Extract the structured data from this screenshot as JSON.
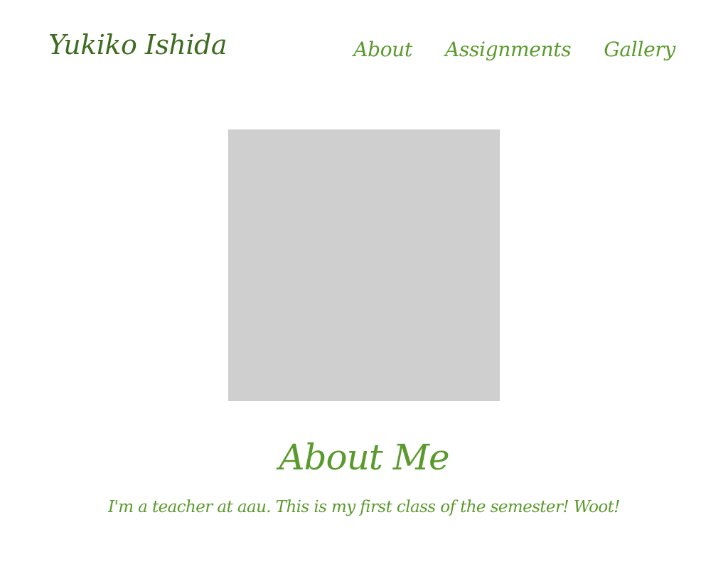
{
  "site": {
    "title": "Yukiko Ishida"
  },
  "nav": {
    "items": [
      {
        "label": "About"
      },
      {
        "label": "Assignments"
      },
      {
        "label": "Gallery"
      }
    ]
  },
  "profile": {
    "photo_placeholder_color": "#cfcfcf"
  },
  "about": {
    "heading": "About Me",
    "text": "I'm a teacher at aau. This is my first class of the semester! Woot!"
  },
  "colors": {
    "title": "#3d6b1f",
    "accent": "#5a9a2c",
    "background": "#ffffff"
  }
}
